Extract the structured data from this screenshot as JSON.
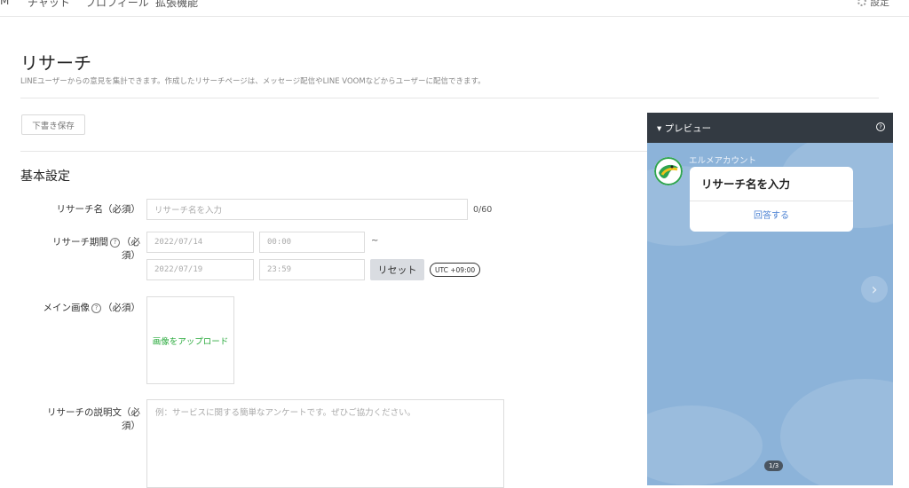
{
  "nav": {
    "items": [
      "M",
      "チャット",
      "プロフィール",
      "拡張機能"
    ],
    "settings": "設定"
  },
  "page": {
    "title": "リサーチ",
    "description": "LINEユーザーからの意見を集計できます。作成したリサーチページは、メッセージ配信やLINE VOOMなどからユーザーに配信できます。"
  },
  "toolbar": {
    "draft_label": "下書き保存"
  },
  "form": {
    "section_title": "基本設定",
    "name": {
      "label": "リサーチ名（必須）",
      "placeholder": "リサーチ名を入力",
      "counter": "0/60"
    },
    "period": {
      "label_line1": "リサーチ期間",
      "label_req1": "（必",
      "label_line2": "須）",
      "help": "?",
      "start_date": "2022/07/14",
      "start_time": "00:00",
      "tilde": "~",
      "end_date": "2022/07/19",
      "end_time": "23:59",
      "reset_label": "リセット",
      "timezone": "UTC +09:00"
    },
    "image": {
      "label_main": "メイン画像",
      "help": "?",
      "label_req": "（必須）",
      "upload_label": "画像をアップロード"
    },
    "description": {
      "label_line1": "リサーチの説明文（必",
      "label_line2": "須）",
      "placeholder": "例：サービスに関する簡単なアンケートです。ぜひご協力ください。"
    }
  },
  "preview": {
    "title": "▾ プレビュー",
    "help": "?",
    "account_name": "エルメアカウント",
    "card_title": "リサーチ名を入力",
    "card_action": "回答する",
    "page_indicator": "1/3",
    "next_arrow": "›"
  },
  "colors": {
    "accent_green": "#2fb55a",
    "preview_bg": "#8cb3d9",
    "link_blue": "#4c82d3"
  }
}
